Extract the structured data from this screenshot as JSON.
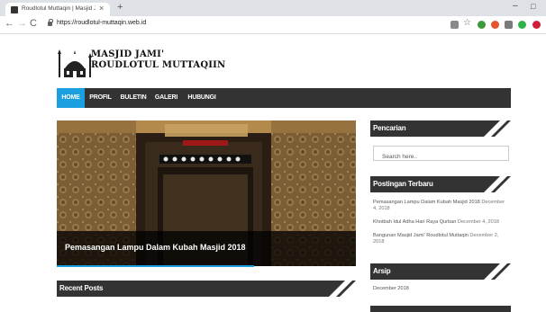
{
  "browser": {
    "tab_title": "Roudlotul Muttaqin | Masjid Jam...",
    "tab_close": "×",
    "new_tab": "+",
    "url": "https://roudlotul-muttaqin.web.id",
    "back": "←",
    "forward": "→",
    "reload": "C",
    "star": "☆",
    "minimize": "–",
    "maximize": "□"
  },
  "site": {
    "title_line1": "MASJID JAMI'",
    "title_line2": "ROUDLOTUL MUTTAQIIN"
  },
  "menu": {
    "items": [
      "HOME",
      "PROFIL",
      "BULETIN",
      "GALERI",
      "HUBUNGI"
    ],
    "active_index": 0
  },
  "slider": {
    "caption": "Pemasangan Lampu Dalam Kubah Masjid 2018",
    "progress_percent": 66
  },
  "main": {
    "recent_posts_heading": "Recent Posts"
  },
  "sidebar": {
    "search_heading": "Pencarian",
    "search_placeholder": "Search here..",
    "latest_heading": "Postingan Terbaru",
    "posts": [
      {
        "title": "Pemasangan Lampu Dalam Kubah Masjid 2018",
        "date": "December 4, 2018"
      },
      {
        "title": "Khotbah Idul Adha Hari Raya Qurban",
        "date": "December 4, 2018"
      },
      {
        "title": "Bangunan Masjid Jami' Roudlotul Muttaqin",
        "date": "December 2, 2018"
      }
    ],
    "archive_heading": "Arsip",
    "archive_items": [
      "December 2018"
    ]
  },
  "colors": {
    "menu_bg": "#333333",
    "accent": "#1aa0e0",
    "header_bg": "#333333"
  }
}
